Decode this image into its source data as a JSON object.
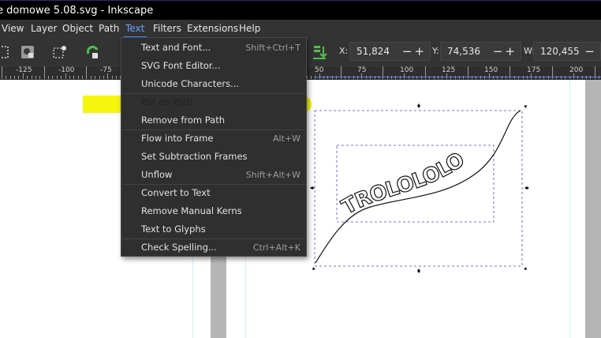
{
  "window": {
    "title": "e domowe 5.08.svg - Inkscape"
  },
  "menubar": [
    {
      "id": "view",
      "label": "View"
    },
    {
      "id": "layer",
      "label": "Layer"
    },
    {
      "id": "object",
      "label": "Object"
    },
    {
      "id": "path",
      "label": "Path"
    },
    {
      "id": "text",
      "label": "Text"
    },
    {
      "id": "filters",
      "label": "Filters"
    },
    {
      "id": "extensions",
      "label": "Extensions"
    },
    {
      "id": "help",
      "label": "Help"
    }
  ],
  "toolbar": {
    "x": {
      "label": "X:",
      "value": "51,824"
    },
    "y": {
      "label": "Y:",
      "value": "74,536"
    },
    "w": {
      "label": "W:",
      "value": "120,455"
    },
    "minus": "−",
    "plus": "+"
  },
  "ruler": {
    "labels": [
      "-125",
      "-100",
      "-75",
      "50",
      "75",
      "100",
      "125",
      "150",
      "175",
      "200"
    ]
  },
  "text_menu": {
    "items": [
      {
        "label": "Text and Font...",
        "shortcut": "Shift+Ctrl+T"
      },
      {
        "label": "SVG Font Editor...",
        "shortcut": ""
      },
      {
        "label": "Unicode Characters...",
        "shortcut": ""
      },
      {
        "label": "Put on Path",
        "shortcut": "",
        "highlighted": true
      },
      {
        "label": "Remove from Path",
        "shortcut": ""
      },
      {
        "label": "Flow into Frame",
        "shortcut": "Alt+W"
      },
      {
        "label": "Set Subtraction Frames",
        "shortcut": ""
      },
      {
        "label": "Unflow",
        "shortcut": "Shift+Alt+W"
      },
      {
        "label": "Convert to Text",
        "shortcut": ""
      },
      {
        "label": "Remove Manual Kerns",
        "shortcut": ""
      },
      {
        "label": "Text to Glyphs",
        "shortcut": ""
      },
      {
        "label": "Check Spelling...",
        "shortcut": "Ctrl+Alt+K"
      }
    ]
  },
  "canvas": {
    "path_text": "TROLOLOLO",
    "highlight_color": "#f5f500",
    "selection_color": "#4a4ad0"
  }
}
